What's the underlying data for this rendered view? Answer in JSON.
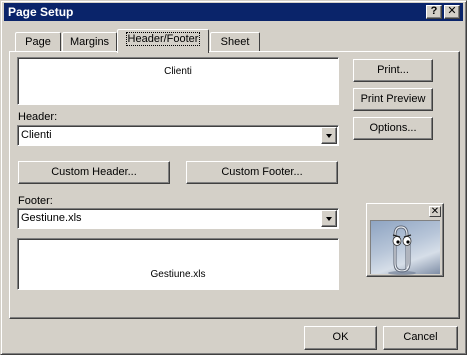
{
  "window": {
    "title": "Page Setup",
    "help_label": "?",
    "close_label": "✕"
  },
  "tabs": [
    {
      "label": "Page",
      "active": false
    },
    {
      "label": "Margins",
      "active": false
    },
    {
      "label": "Header/Footer",
      "active": true
    },
    {
      "label": "Sheet",
      "active": false
    }
  ],
  "header": {
    "preview_text": "Clienti",
    "label": "Header:",
    "value": "Clienti",
    "custom_button": "Custom Header..."
  },
  "footer": {
    "preview_text": "Gestiune.xls",
    "label": "Footer:",
    "value": "Gestiune.xls",
    "custom_button": "Custom Footer..."
  },
  "side_buttons": {
    "print": "Print...",
    "print_preview": "Print Preview",
    "options": "Options..."
  },
  "assistant": {
    "close_label": "✕",
    "character": "paperclip-assistant"
  },
  "bottom_buttons": {
    "ok": "OK",
    "cancel": "Cancel"
  },
  "colors": {
    "titlebar": "#0a246a",
    "face": "#d4d0c8"
  }
}
